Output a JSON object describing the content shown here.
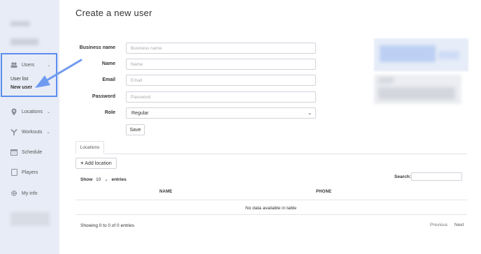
{
  "sidebar": {
    "users": {
      "label": "Users",
      "icon": "users-icon"
    },
    "users_sub": [
      {
        "label": "User list",
        "active": false
      },
      {
        "label": "New user",
        "active": true
      }
    ],
    "items": [
      {
        "label": "Locations",
        "icon": "map-pin-icon",
        "has_chevron": true
      },
      {
        "label": "Workouts",
        "icon": "workout-icon",
        "has_chevron": true
      },
      {
        "label": "Schedule",
        "icon": "calendar-icon",
        "has_chevron": false
      },
      {
        "label": "Players",
        "icon": "tablet-icon",
        "has_chevron": false
      },
      {
        "label": "My info",
        "icon": "gear-icon",
        "has_chevron": false
      }
    ]
  },
  "page": {
    "title": "Create a new user"
  },
  "form": {
    "business_name": {
      "label": "Business name",
      "placeholder": "Business name",
      "value": ""
    },
    "name": {
      "label": "Name",
      "placeholder": "Name",
      "value": ""
    },
    "email": {
      "label": "Email",
      "placeholder": "Email",
      "value": ""
    },
    "password": {
      "label": "Password",
      "placeholder": "Password",
      "value": ""
    },
    "role": {
      "label": "Role",
      "selected": "Regular"
    },
    "save_label": "Save"
  },
  "tabs": [
    {
      "label": "Locations",
      "active": true
    }
  ],
  "locations": {
    "add_label": "Add location",
    "show_label": "Show",
    "entries_count": "10",
    "entries_label": "entries",
    "search_label": "Search:",
    "search_value": "",
    "columns": [
      "NAME",
      "PHONE"
    ],
    "empty_text": "No data available in table",
    "info_text": "Showing 0 to 0 of 0 entries",
    "prev_label": "Previous",
    "next_label": "Next"
  },
  "colors": {
    "sidebar_bg": "#e8ecf6",
    "highlight": "#5b8def"
  }
}
